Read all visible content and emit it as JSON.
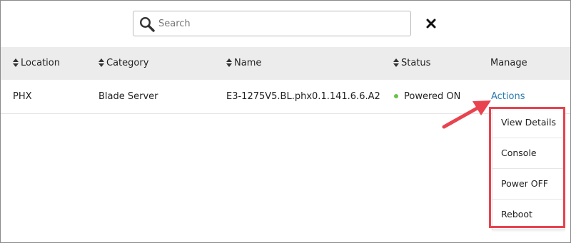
{
  "search": {
    "placeholder": "Search",
    "value": ""
  },
  "icons": {
    "search": "search-icon",
    "clear": "close-icon",
    "sort": "sort-icon"
  },
  "table": {
    "columns": [
      {
        "key": "location",
        "label": "Location",
        "sortable": true
      },
      {
        "key": "category",
        "label": "Category",
        "sortable": true
      },
      {
        "key": "name",
        "label": "Name",
        "sortable": true
      },
      {
        "key": "status",
        "label": "Status",
        "sortable": true
      },
      {
        "key": "manage",
        "label": "Manage",
        "sortable": false
      }
    ],
    "rows": [
      {
        "location": "PHX",
        "category": "Blade Server",
        "name": "E3-1275V5.BL.phx0.1.141.6.6.A2",
        "status": "Powered ON",
        "manage": "Actions"
      }
    ]
  },
  "actions_menu": {
    "items": [
      {
        "label": "View Details"
      },
      {
        "label": "Console"
      },
      {
        "label": "Power OFF"
      },
      {
        "label": "Reboot"
      }
    ]
  },
  "colors": {
    "header_bg": "#ececec",
    "link": "#2a7ab0",
    "status_on": "#6cc04a",
    "annotation": "#e8434f"
  }
}
